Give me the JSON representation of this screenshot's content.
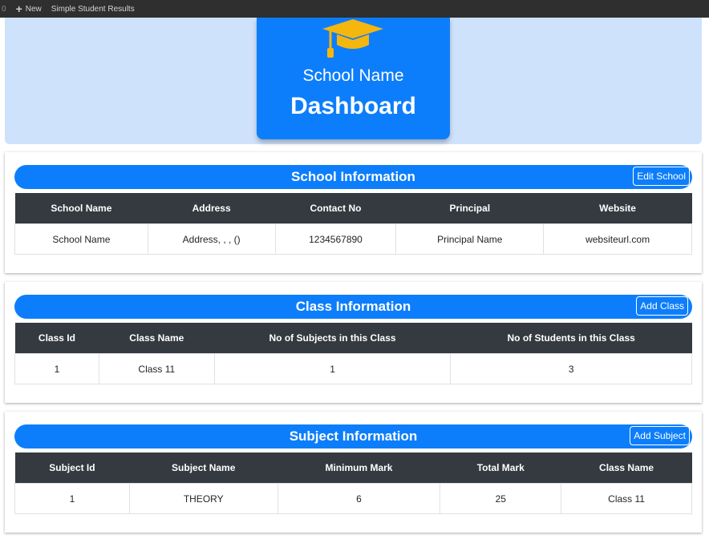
{
  "adminbar": {
    "comments": "0",
    "new_label": "New",
    "site_title": "Simple Student Results"
  },
  "hero": {
    "school_name": "School Name",
    "title": "Dashboard"
  },
  "school_panel": {
    "title": "School Information",
    "button": "Edit School",
    "headers": [
      "School Name",
      "Address",
      "Contact No",
      "Principal",
      "Website"
    ],
    "rows": [
      [
        "School Name",
        "Address, , , ()",
        "1234567890",
        "Principal Name",
        "websiteurl.com"
      ]
    ]
  },
  "class_panel": {
    "title": "Class Information",
    "button": "Add Class",
    "headers": [
      "Class Id",
      "Class Name",
      "No of Subjects in this Class",
      "No of Students in this Class"
    ],
    "rows": [
      [
        "1",
        "Class 11",
        "1",
        "3"
      ]
    ]
  },
  "subject_panel": {
    "title": "Subject Information",
    "button": "Add Subject",
    "headers": [
      "Subject Id",
      "Subject Name",
      "Minimum Mark",
      "Total Mark",
      "Class Name"
    ],
    "rows": [
      [
        "1",
        "THEORY",
        "6",
        "25",
        "Class 11"
      ]
    ]
  },
  "colors": {
    "primary": "#0d7efb",
    "table_header": "#343a40",
    "banner": "#cfe2fc",
    "cap": "#f5b60e"
  }
}
